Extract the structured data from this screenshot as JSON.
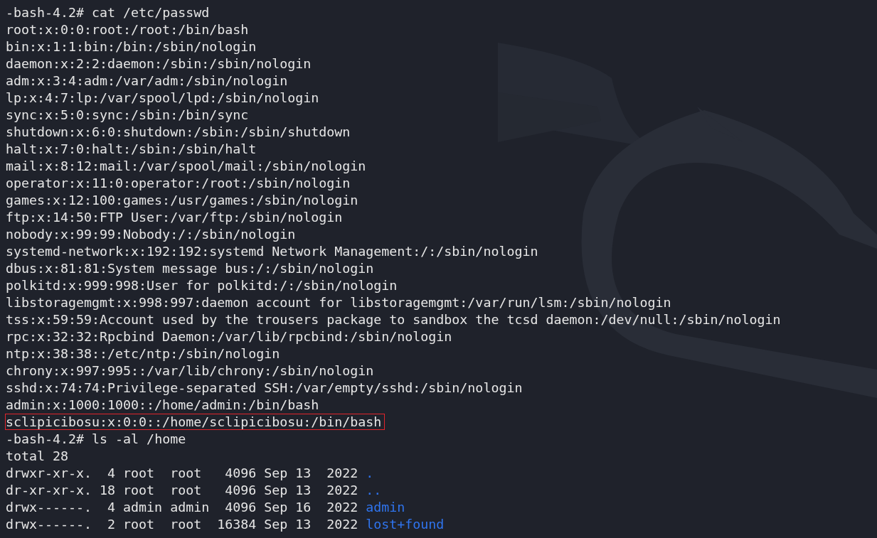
{
  "terminal": {
    "lines": [
      {
        "kind": "command",
        "prompt": "-bash-4.2#",
        "command": "cat /etc/passwd"
      },
      {
        "kind": "output",
        "text": "root:x:0:0:root:/root:/bin/bash",
        "highlighted": false
      },
      {
        "kind": "output",
        "text": "bin:x:1:1:bin:/bin:/sbin/nologin",
        "highlighted": false
      },
      {
        "kind": "output",
        "text": "daemon:x:2:2:daemon:/sbin:/sbin/nologin",
        "highlighted": false
      },
      {
        "kind": "output",
        "text": "adm:x:3:4:adm:/var/adm:/sbin/nologin",
        "highlighted": false
      },
      {
        "kind": "output",
        "text": "lp:x:4:7:lp:/var/spool/lpd:/sbin/nologin",
        "highlighted": false
      },
      {
        "kind": "output",
        "text": "sync:x:5:0:sync:/sbin:/bin/sync",
        "highlighted": false
      },
      {
        "kind": "output",
        "text": "shutdown:x:6:0:shutdown:/sbin:/sbin/shutdown",
        "highlighted": false
      },
      {
        "kind": "output",
        "text": "halt:x:7:0:halt:/sbin:/sbin/halt",
        "highlighted": false
      },
      {
        "kind": "output",
        "text": "mail:x:8:12:mail:/var/spool/mail:/sbin/nologin",
        "highlighted": false
      },
      {
        "kind": "output",
        "text": "operator:x:11:0:operator:/root:/sbin/nologin",
        "highlighted": false
      },
      {
        "kind": "output",
        "text": "games:x:12:100:games:/usr/games:/sbin/nologin",
        "highlighted": false
      },
      {
        "kind": "output",
        "text": "ftp:x:14:50:FTP User:/var/ftp:/sbin/nologin",
        "highlighted": false
      },
      {
        "kind": "output",
        "text": "nobody:x:99:99:Nobody:/:/sbin/nologin",
        "highlighted": false
      },
      {
        "kind": "output",
        "text": "systemd-network:x:192:192:systemd Network Management:/:/sbin/nologin",
        "highlighted": false
      },
      {
        "kind": "output",
        "text": "dbus:x:81:81:System message bus:/:/sbin/nologin",
        "highlighted": false
      },
      {
        "kind": "output",
        "text": "polkitd:x:999:998:User for polkitd:/:/sbin/nologin",
        "highlighted": false
      },
      {
        "kind": "output",
        "text": "libstoragemgmt:x:998:997:daemon account for libstoragemgmt:/var/run/lsm:/sbin/nologin",
        "highlighted": false
      },
      {
        "kind": "output",
        "text": "tss:x:59:59:Account used by the trousers package to sandbox the tcsd daemon:/dev/null:/sbin/nologin",
        "highlighted": false
      },
      {
        "kind": "output",
        "text": "rpc:x:32:32:Rpcbind Daemon:/var/lib/rpcbind:/sbin/nologin",
        "highlighted": false
      },
      {
        "kind": "output",
        "text": "ntp:x:38:38::/etc/ntp:/sbin/nologin",
        "highlighted": false
      },
      {
        "kind": "output",
        "text": "chrony:x:997:995::/var/lib/chrony:/sbin/nologin",
        "highlighted": false
      },
      {
        "kind": "output",
        "text": "sshd:x:74:74:Privilege-separated SSH:/var/empty/sshd:/sbin/nologin",
        "highlighted": false
      },
      {
        "kind": "output",
        "text": "admin:x:1000:1000::/home/admin:/bin/bash",
        "highlighted": false
      },
      {
        "kind": "output",
        "text": "sclipicibosu:x:0:0::/home/sclipicibosu:/bin/bash",
        "highlighted": true
      },
      {
        "kind": "command",
        "prompt": "-bash-4.2#",
        "command": "ls -al /home"
      },
      {
        "kind": "output",
        "text": "total 28",
        "highlighted": false
      },
      {
        "kind": "listing",
        "fields": "drwxr-xr-x.  4 root  root   4096 Sep 13  2022",
        "entry": "."
      },
      {
        "kind": "listing",
        "fields": "dr-xr-xr-x. 18 root  root   4096 Sep 13  2022",
        "entry": ".."
      },
      {
        "kind": "listing",
        "fields": "drwx------.  4 admin admin  4096 Sep 16  2022",
        "entry": "admin"
      },
      {
        "kind": "listing",
        "fields": "drwx------.  2 root  root  16384 Sep 13  2022",
        "entry": "lost+found"
      }
    ]
  }
}
